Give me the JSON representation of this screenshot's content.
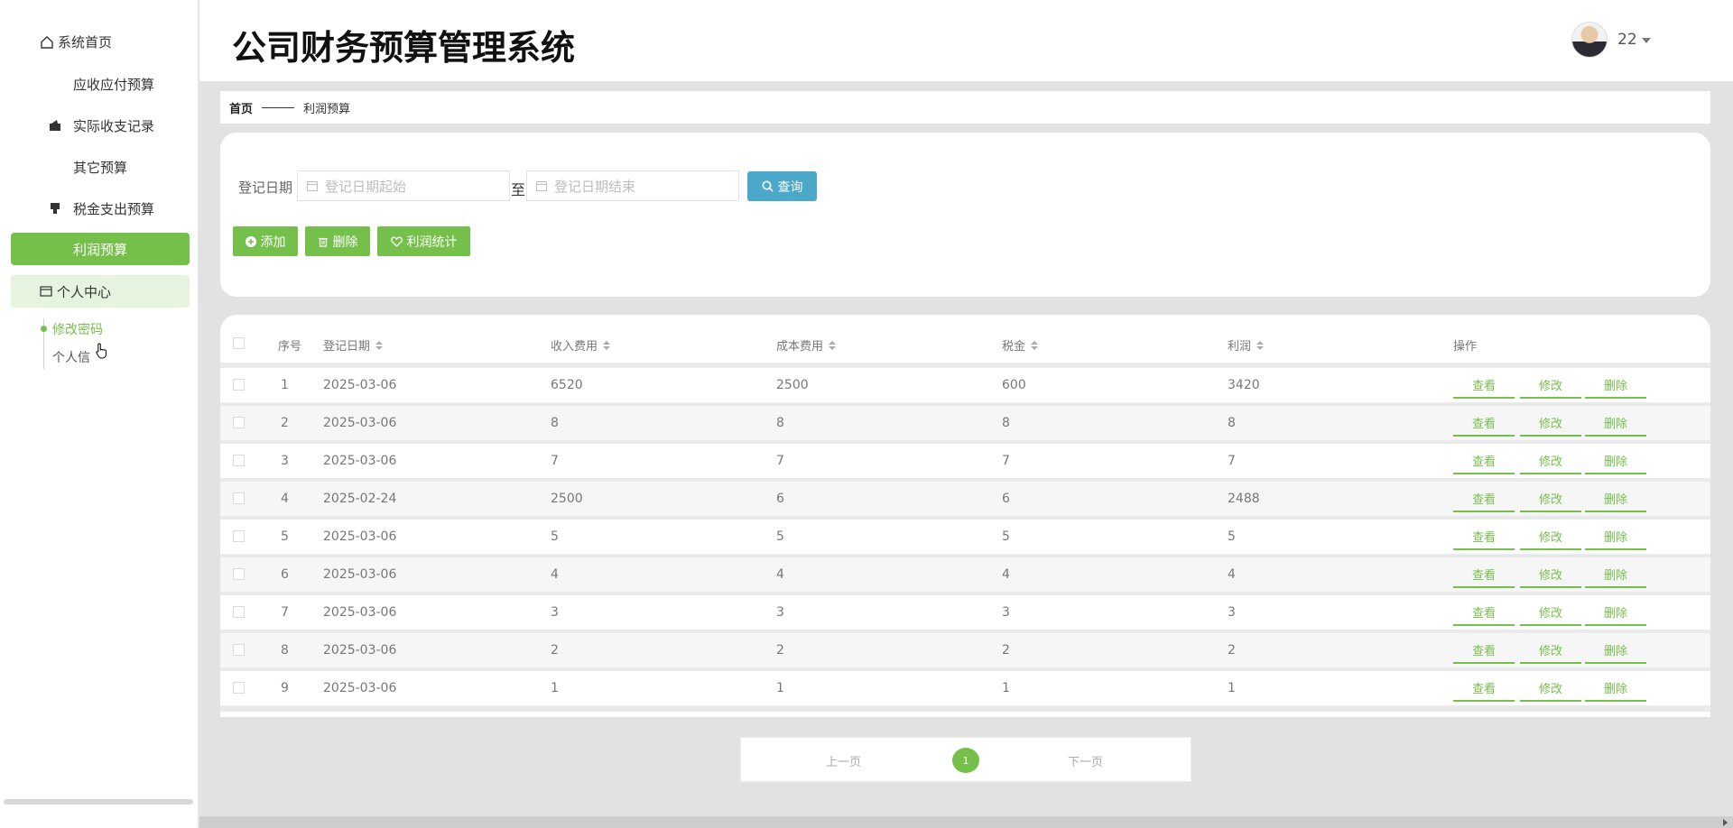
{
  "app": {
    "title": "公司财务预算管理系统"
  },
  "user": {
    "name": "22"
  },
  "sidebar": {
    "home": "系统首页",
    "items": [
      {
        "label": "应收应付预算",
        "icon": "grid-icon"
      },
      {
        "label": "实际收支记录",
        "icon": "wallet-icon"
      },
      {
        "label": "其它预算",
        "icon": "grid-icon"
      },
      {
        "label": "税金支出预算",
        "icon": "stamp-icon"
      },
      {
        "label": "利润预算",
        "icon": "grid-icon",
        "active": true
      }
    ],
    "group": "个人中心",
    "sub_items": [
      {
        "label": "修改密码",
        "active": true
      },
      {
        "label": "个人信"
      }
    ]
  },
  "breadcrumb": {
    "home": "首页",
    "current": "利润预算"
  },
  "search": {
    "date_label": "登记日期",
    "start_placeholder": "登记日期起始",
    "to_text": "至",
    "end_placeholder": "登记日期结束",
    "query_button": "查询"
  },
  "toolbar": {
    "add": "添加",
    "delete": "删除",
    "stats": "利润统计"
  },
  "table": {
    "columns": [
      "序号",
      "登记日期",
      "收入费用",
      "成本费用",
      "税金",
      "利润",
      "操作"
    ],
    "actions": [
      "查看",
      "修改",
      "删除"
    ],
    "rows": [
      [
        "1",
        "2025-03-06",
        "6520",
        "2500",
        "600",
        "3420"
      ],
      [
        "2",
        "2025-03-06",
        "8",
        "8",
        "8",
        "8"
      ],
      [
        "3",
        "2025-03-06",
        "7",
        "7",
        "7",
        "7"
      ],
      [
        "4",
        "2025-02-24",
        "2500",
        "6",
        "6",
        "2488"
      ],
      [
        "5",
        "2025-03-06",
        "5",
        "5",
        "5",
        "5"
      ],
      [
        "6",
        "2025-03-06",
        "4",
        "4",
        "4",
        "4"
      ],
      [
        "7",
        "2025-03-06",
        "3",
        "3",
        "3",
        "3"
      ],
      [
        "8",
        "2025-03-06",
        "2",
        "2",
        "2",
        "2"
      ],
      [
        "9",
        "2025-03-06",
        "1",
        "1",
        "1",
        "1"
      ]
    ]
  },
  "pagination": {
    "prev": "上一页",
    "current": "1",
    "next": "下一页"
  },
  "colors": {
    "primary": "#75c04a",
    "query": "#4ba8c9"
  }
}
